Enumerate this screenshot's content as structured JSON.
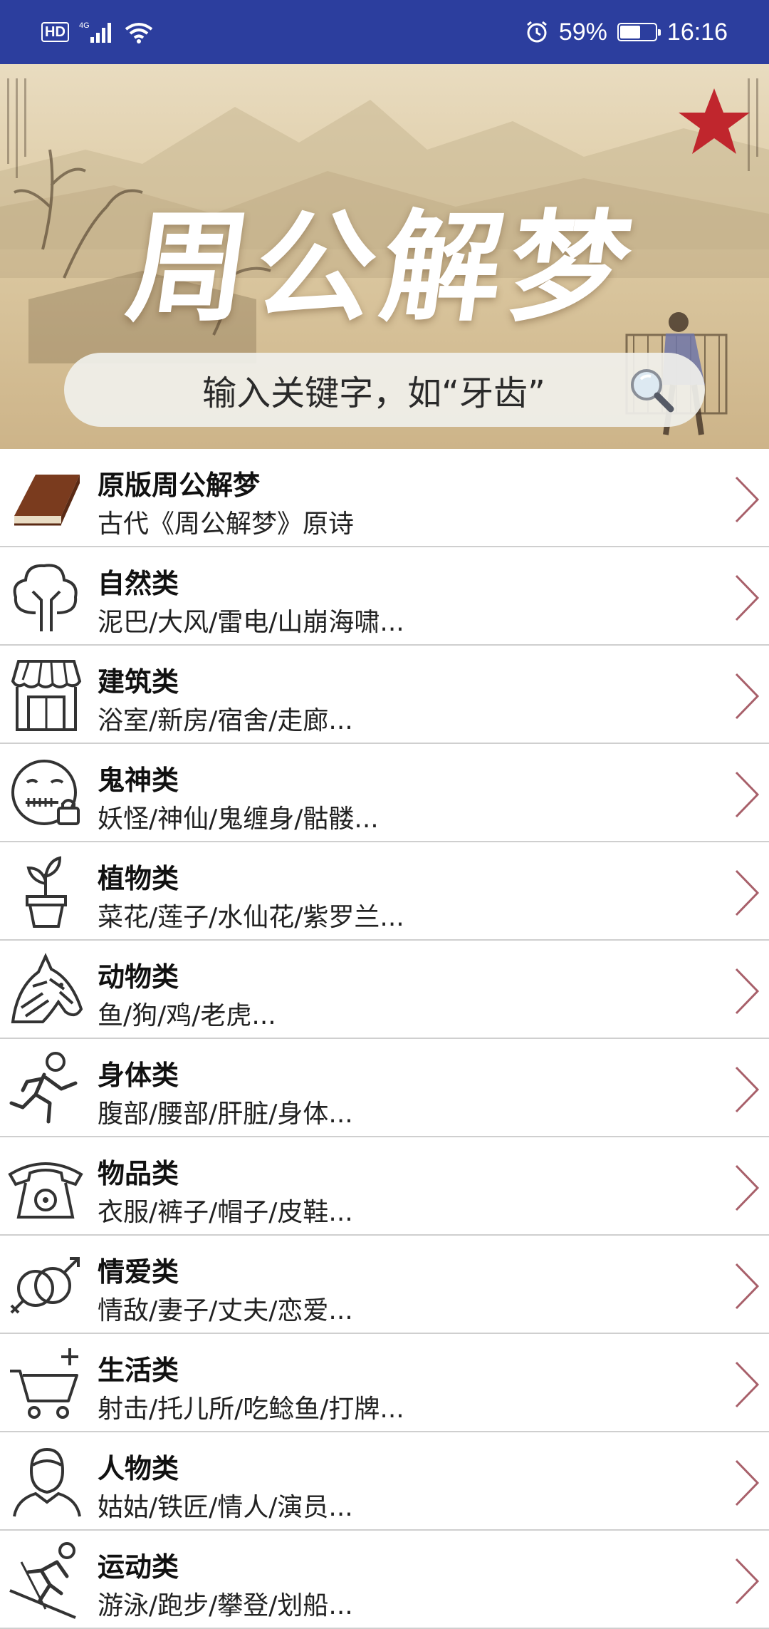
{
  "status_bar": {
    "hd": "HD",
    "network": "4G",
    "battery_pct": "59%",
    "battery_level": 0.59,
    "time": "16:16"
  },
  "banner": {
    "title": "周公解梦",
    "search_placeholder": "输入关键字，如“牙齿”"
  },
  "categories": [
    {
      "title": "原版周公解梦",
      "subtitle": "古代《周公解梦》原诗",
      "icon": "book-icon"
    },
    {
      "title": "自然类",
      "subtitle": "泥巴/大风/雷电/山崩海啸...",
      "icon": "tree-icon"
    },
    {
      "title": "建筑类",
      "subtitle": "浴室/新房/宿舍/走廊...",
      "icon": "store-icon"
    },
    {
      "title": "鬼神类",
      "subtitle": "妖怪/神仙/鬼缠身/骷髅...",
      "icon": "zipped-face-icon"
    },
    {
      "title": "植物类",
      "subtitle": "菜花/莲子/水仙花/紫罗兰...",
      "icon": "potted-plant-icon"
    },
    {
      "title": "动物类",
      "subtitle": "鱼/狗/鸡/老虎...",
      "icon": "zebra-icon"
    },
    {
      "title": "身体类",
      "subtitle": "腹部/腰部/肝脏/身体...",
      "icon": "running-person-icon"
    },
    {
      "title": "物品类",
      "subtitle": "衣服/裤子/帽子/皮鞋...",
      "icon": "telephone-icon"
    },
    {
      "title": "情爱类",
      "subtitle": "情敌/妻子/丈夫/恋爱...",
      "icon": "gender-rings-icon"
    },
    {
      "title": "生活类",
      "subtitle": "射击/托儿所/吃鲶鱼/打牌...",
      "icon": "shopping-cart-icon"
    },
    {
      "title": "人物类",
      "subtitle": "姑姑/铁匠/情人/演员...",
      "icon": "person-icon"
    },
    {
      "title": "运动类",
      "subtitle": "游泳/跑步/攀登/划船...",
      "icon": "skier-icon"
    }
  ],
  "colors": {
    "status_bar": "#2c3e9e",
    "star": "#c0262d",
    "chevron": "#a8606a"
  }
}
